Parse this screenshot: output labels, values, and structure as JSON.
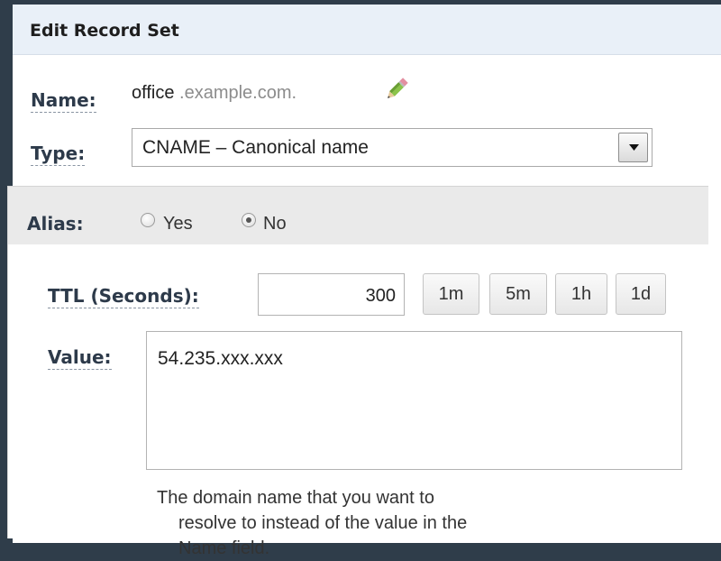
{
  "dialog": {
    "title": "Edit Record Set"
  },
  "name": {
    "label": "Name:",
    "prefix": "office",
    "domain": " .example.com.",
    "edit_icon": "pencil-icon"
  },
  "type": {
    "label": "Type:",
    "selected": "CNAME – Canonical name",
    "dropdown_icon": "triangle-down-icon"
  },
  "alias": {
    "label": "Alias:",
    "options": [
      "Yes",
      "No"
    ],
    "selected": "No"
  },
  "ttl": {
    "label": "TTL (Seconds):",
    "value": "300",
    "presets": [
      "1m",
      "5m",
      "1h",
      "1d"
    ]
  },
  "value": {
    "label": "Value:",
    "text": "54.235.xxx.xxx"
  },
  "help": {
    "line1": "The domain name that you want to",
    "line2": "resolve to instead of the value in the",
    "line3": "Name field."
  },
  "colors": {
    "background": "#2f3d4a",
    "header": "#e9f0f8",
    "label": "#2d3a4a",
    "alias_bar": "#eaeaea"
  }
}
